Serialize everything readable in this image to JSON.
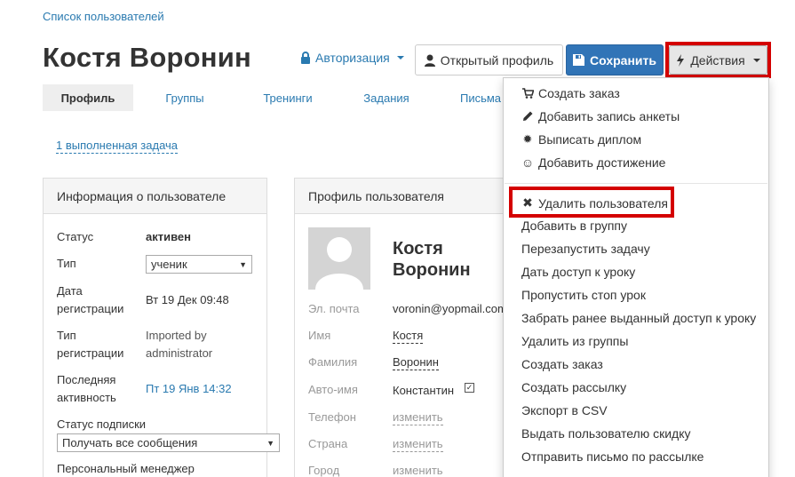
{
  "breadcrumb": "Список пользователей",
  "title": "Костя Воронин",
  "header": {
    "auth_label": "Авторизация",
    "open_profile_label": "Открытый профиль",
    "save_label": "Сохранить",
    "actions_label": "Действия"
  },
  "tabs": [
    "Профиль",
    "Группы",
    "Тренинги",
    "Задания",
    "Письма"
  ],
  "completed_task_link": "1 выполненная задача",
  "info_panel": {
    "title": "Информация о пользователе",
    "status_label": "Статус",
    "status_value": "активен",
    "type_label": "Тип",
    "type_value": "ученик",
    "reg_date_label_1": "Дата",
    "reg_date_label_2": "регистрации",
    "reg_date_value": "Вт 19 Дек 09:48",
    "reg_type_label_1": "Тип",
    "reg_type_label_2": "регистрации",
    "reg_type_value_1": "Imported by",
    "reg_type_value_2": "administrator",
    "last_activity_label_1": "Последняя",
    "last_activity_label_2": "активность",
    "last_activity_value": "Пт 19 Янв 14:32",
    "subscription_label": "Статус подписки",
    "subscription_value": "Получать все сообщения",
    "manager_label": "Персональный менеджер"
  },
  "profile_panel": {
    "title": "Профиль пользователя",
    "name_line_1": "Костя",
    "name_line_2": "Воронин",
    "email_label": "Эл. почта",
    "email_value": "voronin@yopmail.com",
    "first_name_label": "Имя",
    "first_name_value": "Костя",
    "last_name_label": "Фамилия",
    "last_name_value": "Воронин",
    "auto_name_label": "Авто-имя",
    "auto_name_value": "Константин",
    "phone_label": "Телефон",
    "phone_value": "изменить",
    "country_label": "Страна",
    "country_value": "изменить",
    "city_label": "Город",
    "city_value": "изменить"
  },
  "actions_menu": {
    "create_order": "Создать заказ",
    "add_form_entry": "Добавить запись анкеты",
    "issue_diploma": "Выписать диплом",
    "add_achievement": "Добавить достижение",
    "delete_user": "Удалить пользователя",
    "add_to_group": "Добавить в группу",
    "restart_task": "Перезапустить задачу",
    "grant_lesson_access": "Дать доступ к уроку",
    "skip_stop_lesson": "Пропустить стоп урок",
    "revoke_lesson_access": "Забрать ранее выданный доступ к уроку",
    "remove_from_group": "Удалить из группы",
    "create_order_2": "Создать заказ",
    "create_mailing": "Создать рассылку",
    "export_csv": "Экспорт в CSV",
    "give_discount": "Выдать пользователю скидку",
    "send_mailing_letter": "Отправить письмо по рассылке"
  },
  "colors": {
    "link": "#2a7ab0",
    "primary_button": "#3174b7",
    "highlight_frame": "#d40000"
  }
}
